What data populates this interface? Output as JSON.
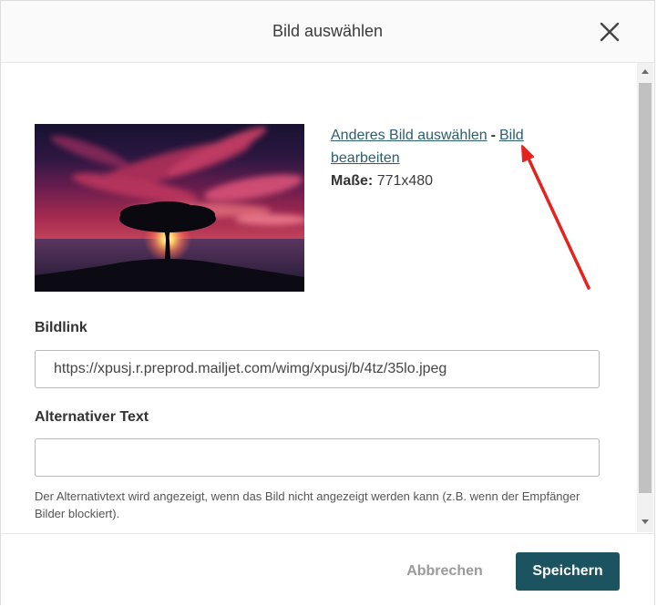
{
  "dialog": {
    "title": "Bild auswählen",
    "close_icon": "close-icon"
  },
  "image_actions": {
    "change_link": "Anderes Bild auswählen",
    "separator": "-",
    "edit_link": "Bild bearbeiten",
    "dimensions_label": "Maße:",
    "dimensions_value": "771x480"
  },
  "fields": {
    "bildlink": {
      "label": "Bildlink",
      "value": "https://xpusj.r.preprod.mailjet.com/wimg/xpusj/b/4tz/35lo.jpeg"
    },
    "alt_text": {
      "label": "Alternativer Text",
      "value": "",
      "help": "Der Alternativtext wird angezeigt, wenn das Bild nicht angezeigt werden kann (z.B. wenn der Empfänger Bilder blockiert)."
    }
  },
  "footer": {
    "cancel_label": "Abbrechen",
    "save_label": "Speichern"
  },
  "scrollbar": {
    "up_icon": "arrow-up-icon",
    "down_icon": "arrow-down-icon"
  },
  "annotation": {
    "type": "arrow",
    "color": "#e5231d"
  },
  "colors": {
    "accent": "#1b5360",
    "link": "#2b5f6e",
    "cancel_text": "#9a9a9a",
    "annotation_arrow": "#e5231d"
  }
}
